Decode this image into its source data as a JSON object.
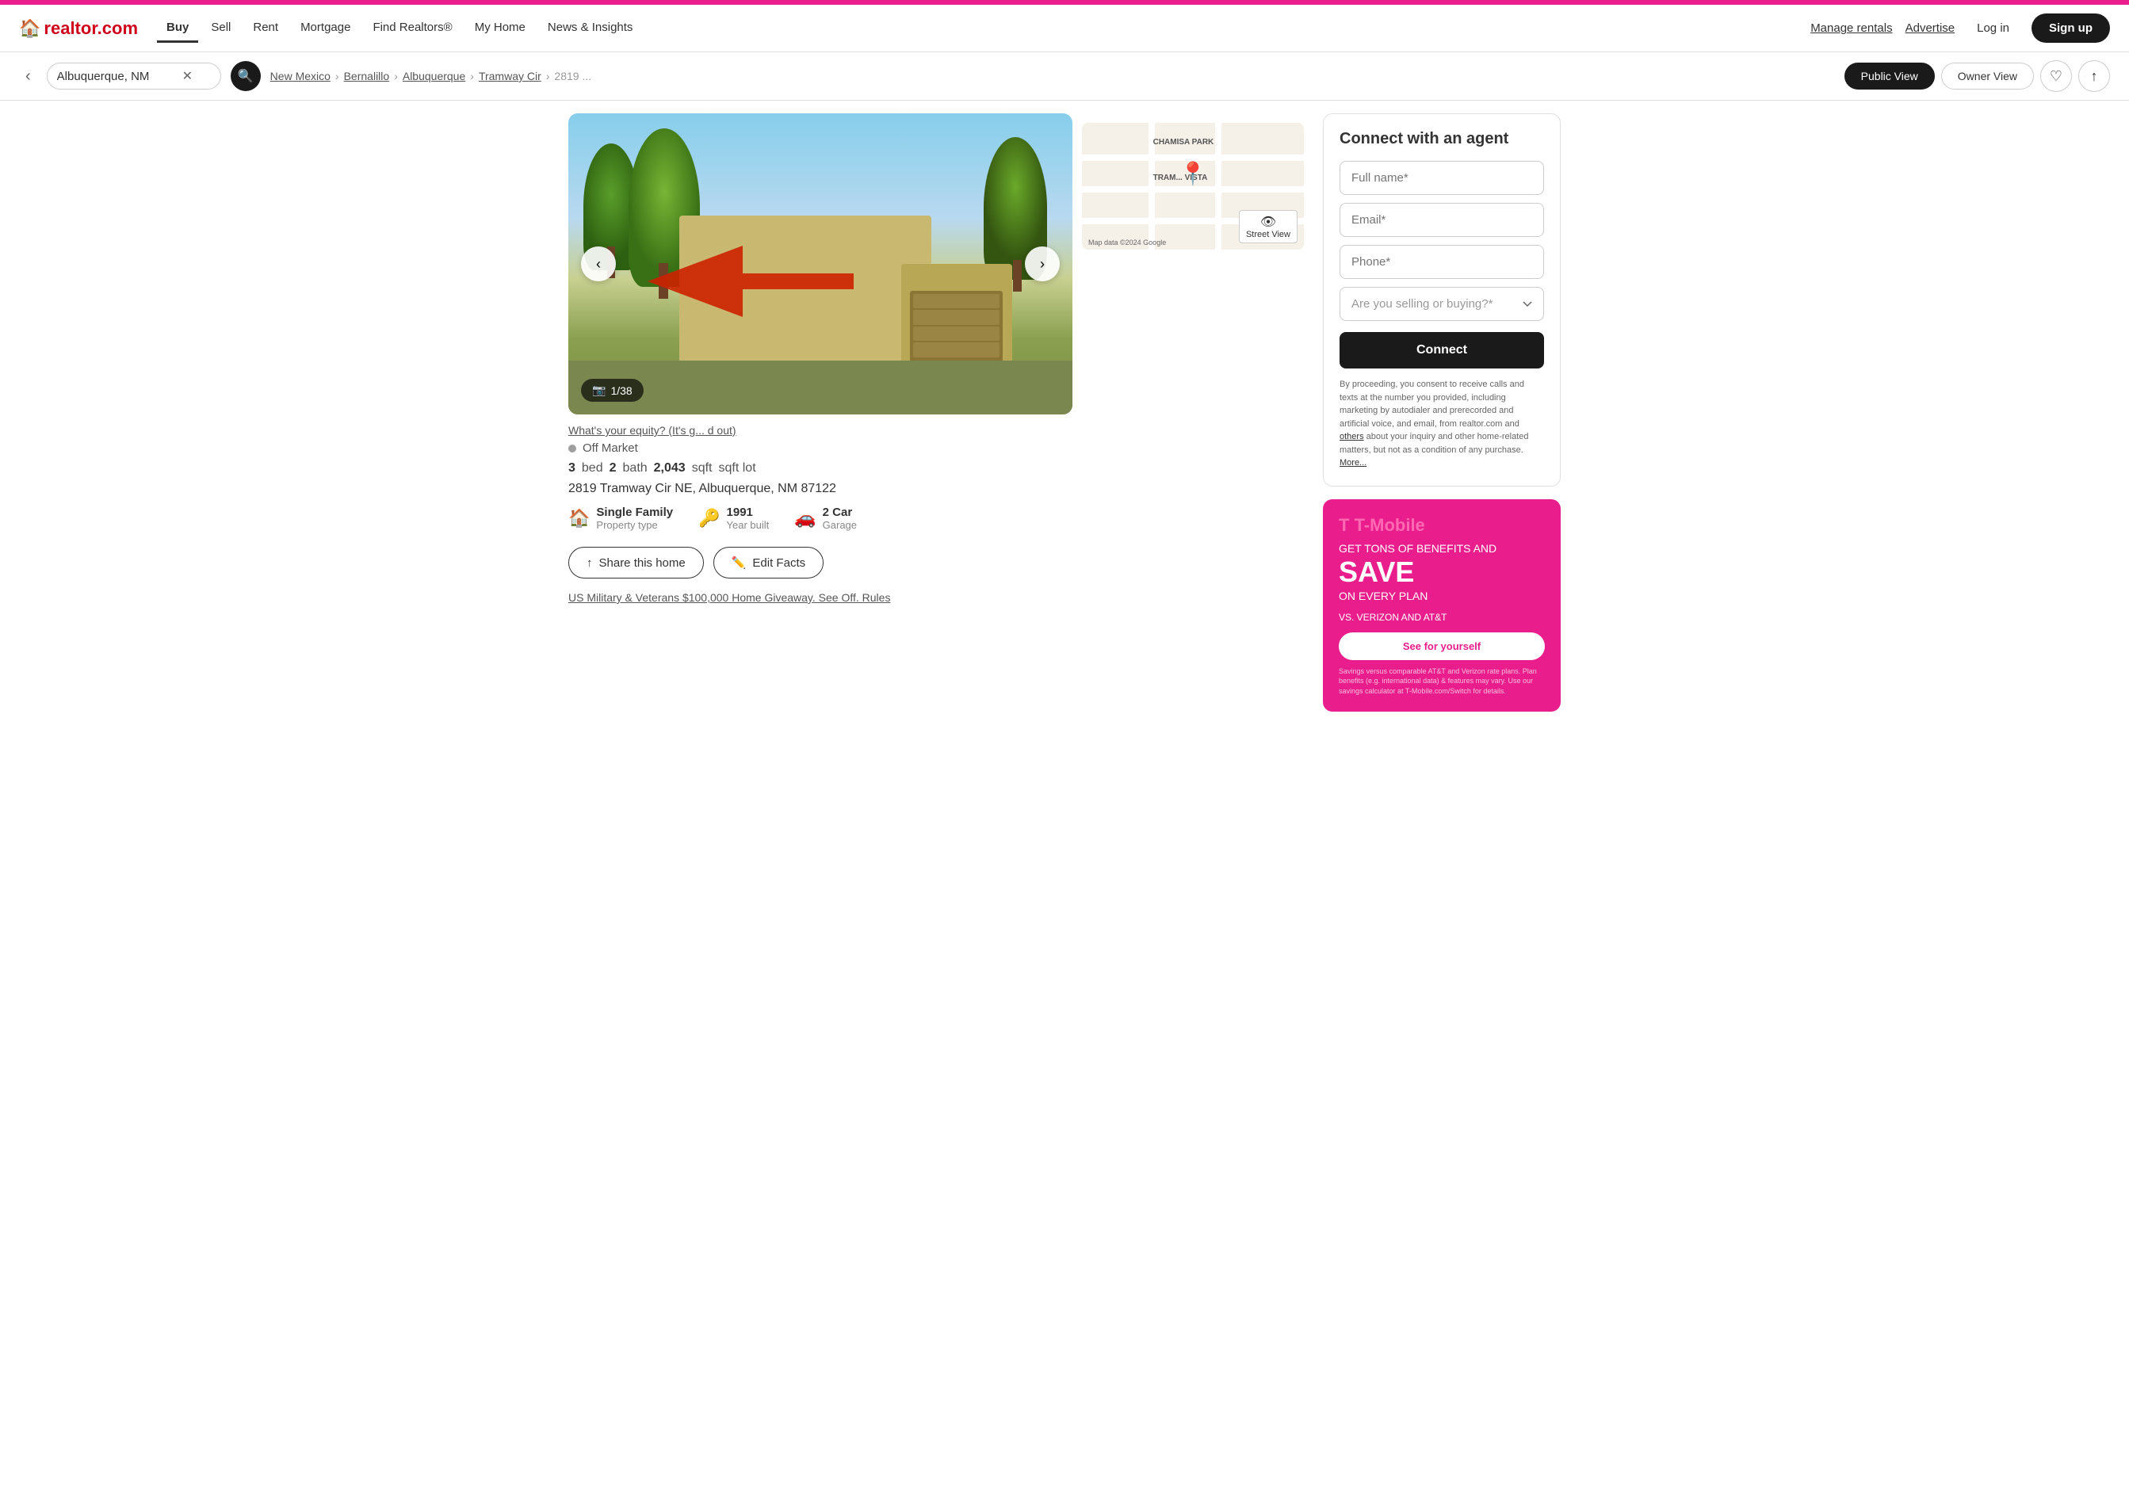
{
  "topBanner": {
    "visible": true
  },
  "navbar": {
    "logo": "realtor.com",
    "logoIcon": "🏠",
    "navLinks": [
      {
        "label": "Buy",
        "active": true
      },
      {
        "label": "Sell",
        "active": false
      },
      {
        "label": "Rent",
        "active": false
      },
      {
        "label": "Mortgage",
        "active": false
      },
      {
        "label": "Find Realtors®",
        "active": false
      },
      {
        "label": "My Home",
        "active": false
      },
      {
        "label": "News & Insights",
        "active": false
      }
    ],
    "manageRentals": "Manage rentals",
    "advertise": "Advertise",
    "login": "Log in",
    "signup": "Sign up"
  },
  "searchBar": {
    "searchValue": "Albuquerque, NM",
    "searchPlaceholder": "Albuquerque, NM",
    "breadcrumb": {
      "state": "New Mexico",
      "county": "Bernalillo",
      "city": "Albuquerque",
      "street": "Tramway Cir",
      "truncated": "2819 ..."
    },
    "publicView": "Public View",
    "ownerView": "Owner View"
  },
  "property": {
    "equityLink": "What's your equity? (It's g... d out)",
    "status": "Off Market",
    "beds": "3",
    "baths": "2",
    "sqft": "2,043",
    "lotSqft": "sqft lot",
    "address": "2819 Tramway Cir NE, Albuquerque, NM 87122",
    "type": "Single Family",
    "typeLabel": "Property type",
    "yearBuilt": "1991",
    "yearBuiltLabel": "Year built",
    "garage": "2 Car",
    "garageLabel": "Garage",
    "photoCount": "1/38",
    "shareBtn": "Share this home",
    "editBtn": "Edit Facts"
  },
  "map": {
    "streetViewLabel": "Street View",
    "mapsFooter": "Map data ©2024 Google",
    "googleLabel": "Google",
    "neighborhoodLabel": "CHAMISA PARK",
    "subNeighborhood": "TRAM... VISTA"
  },
  "giveaway": {
    "text": "US Military & Veterans $100,000 Home Giveaway. See Off. Rules"
  },
  "agentForm": {
    "title": "Connect with an agent",
    "fullNamePlaceholder": "Full name*",
    "emailPlaceholder": "Email*",
    "phonePlaceholder": "Phone*",
    "sellingPlaceholder": "Are you selling or buying?*",
    "connectBtn": "Connect",
    "consent1": "By proceeding, you consent to receive calls and texts at the number you provided, including marketing by autodialer and prerecorded and artificial voice, and email, from realtor.com and",
    "consentLink": "others",
    "consent2": "about your inquiry and other home-related matters, but not as a condition of any purchase.",
    "consentMore": "More..."
  },
  "ad": {
    "brand": "T-Mobile",
    "headline": "GET TONS OF BENEFITS AND",
    "main": "SAVE",
    "sub": "ON EVERY PLAN",
    "tagline": "VS. VERIZON AND AT&T",
    "cta": "See for yourself",
    "disclaimer": "Savings versus comparable AT&T and Verizon rate plans. Plan benefits (e.g. international data) & features may vary. Use our savings calculator at T-Mobile.com/Switch for details."
  }
}
